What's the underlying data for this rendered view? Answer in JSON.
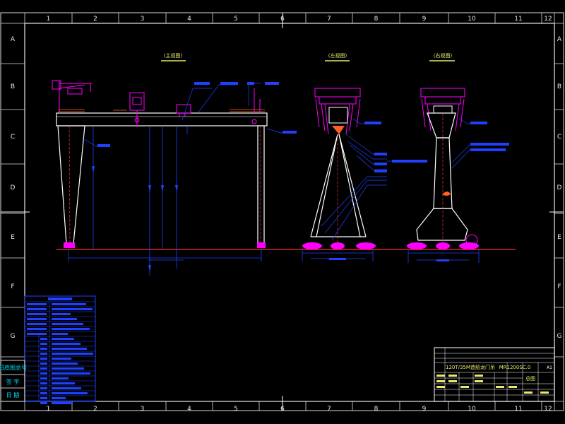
{
  "grid": {
    "columns": [
      "1",
      "2",
      "3",
      "4",
      "5",
      "6",
      "7",
      "8",
      "9",
      "10",
      "11",
      "12"
    ],
    "rows": [
      "A",
      "B",
      "C",
      "D",
      "E",
      "F",
      "G"
    ]
  },
  "title_block": {
    "project": "120T/35M造船龙门吊",
    "drawing_no": "MR1200SC.0",
    "title": "总图",
    "size": "A1"
  },
  "side_stamps": [
    "旧底图总号",
    "签 字",
    "日 期"
  ],
  "view_labels": [
    "(主视图)",
    "(左视图)",
    "(右视图)"
  ],
  "colors": {
    "background": "#000000",
    "frame": "#ffffff",
    "structure": "#ffffff",
    "dimension": "#2040ff",
    "mechanism": "#ff00ff",
    "ground": "#ff3030",
    "label": "#e8e870"
  }
}
